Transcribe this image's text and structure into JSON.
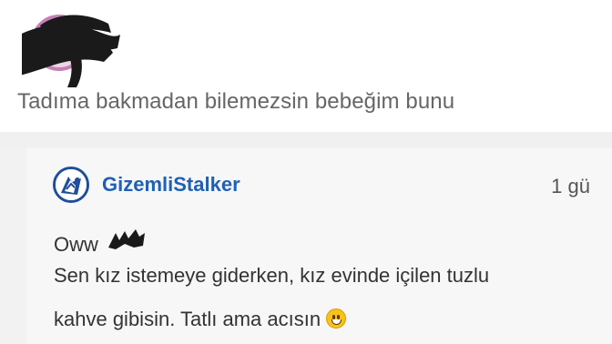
{
  "post": {
    "text": "Tadıma bakmadan bilemezsin bebeğim bunu"
  },
  "reply": {
    "username": "GizemliStalker",
    "timestamp": "1 gü",
    "lines": [
      "Oww",
      "Sen kız istemeye giderken, kız evinde içilen tuzlu",
      "kahve gibisin. Tatlı ama acısın"
    ],
    "emoji": "grinning-face-emoji"
  },
  "colors": {
    "username": "#1f61b3",
    "avatar_ring": "#c77fb8",
    "redaction": "#1a1a1a",
    "background": "#ffffff",
    "reply_background": "#f7f7f7"
  }
}
